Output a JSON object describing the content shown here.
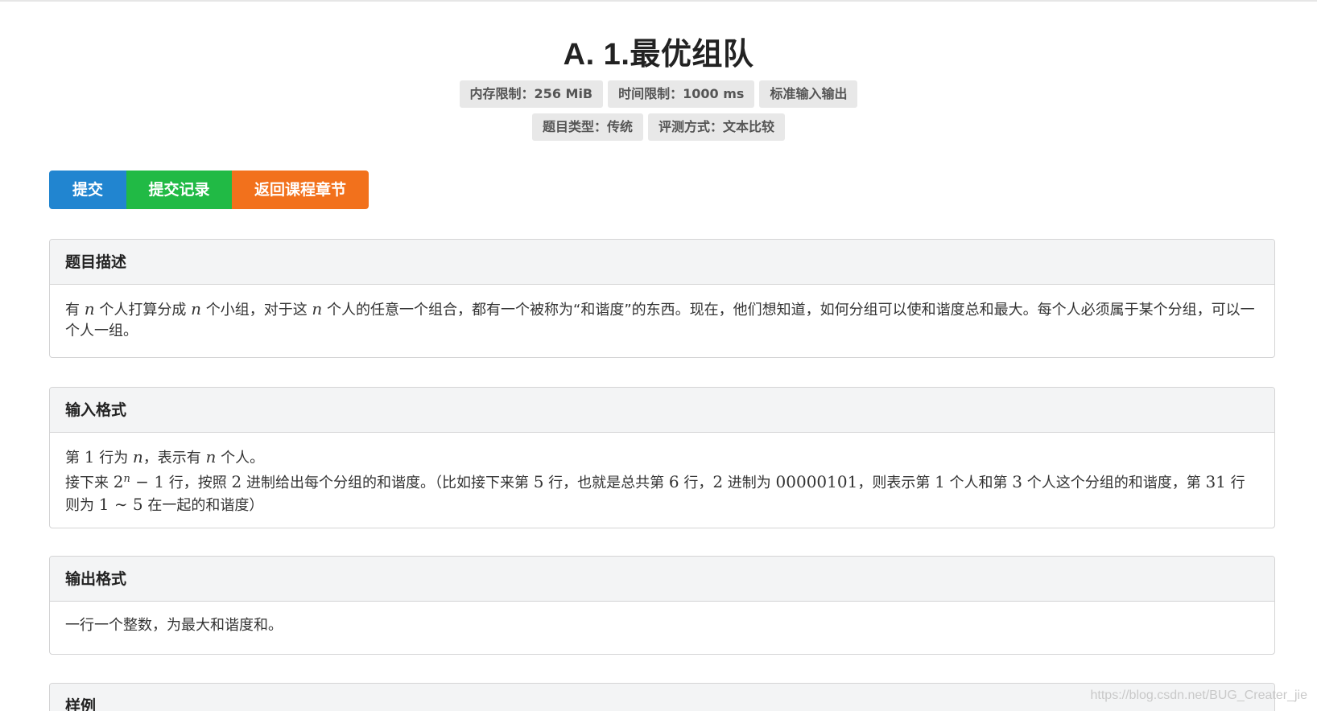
{
  "problem": {
    "title": "A. 1.最优组队"
  },
  "meta": {
    "memory_limit": "内存限制：256 MiB",
    "time_limit": "时间限制：1000 ms",
    "io_type": "标准输入输出",
    "problem_type": "题目类型：传统",
    "judge_mode": "评测方式：文本比较"
  },
  "actions": {
    "submit": "提交",
    "records": "提交记录",
    "back": "返回课程章节"
  },
  "sections": {
    "description": {
      "title": "题目描述",
      "t1": "有 ",
      "m1": "n",
      "t2": " 个人打算分成 ",
      "m2": "n",
      "t3": " 个小组，对于这 ",
      "m3": "n",
      "t4": " 个人的任意一个组合，都有一个被称为“和谐度”的东西。现在，他们想知道，如何分组可以使和谐度总和最大。每个人必须属于某个分组，可以一个人一组。"
    },
    "input": {
      "title": "输入格式",
      "l1_t1": "第 ",
      "l1_m1": "1",
      "l1_t2": " 行为 ",
      "l1_m2": "n",
      "l1_t3": "，表示有 ",
      "l1_m3": "n",
      "l1_t4": " 个人。",
      "l2_t1": "接下来 ",
      "l2_m1": "2",
      "l2_sup": "n",
      "l2_m2": " − 1",
      "l2_t2": " 行，按照 ",
      "l2_m3": "2",
      "l2_t3": " 进制给出每个分组的和谐度。（比如接下来第 ",
      "l2_m4": "5",
      "l2_t4": " 行，也就是总共第 ",
      "l2_m5": "6",
      "l2_t5": " 行，",
      "l2_m6": "2",
      "l2_t6": " 进制为 ",
      "l2_m7": "00000101",
      "l2_t7": "，则表示第 ",
      "l2_m8": "1",
      "l2_t8": " 个人和第 ",
      "l2_m9": "3",
      "l2_t9": " 个人这个分组的和谐度，第 ",
      "l2_m10": "31",
      "l2_t10": " 行则为 ",
      "l2_m11": "1 ∼ 5",
      "l2_t11": " 在一起的和谐度）"
    },
    "output": {
      "title": "输出格式",
      "text": "一行一个整数，为最大和谐度和。"
    },
    "sample": {
      "title": "样例"
    }
  },
  "watermark": "https://blog.csdn.net/BUG_Creater_jie"
}
